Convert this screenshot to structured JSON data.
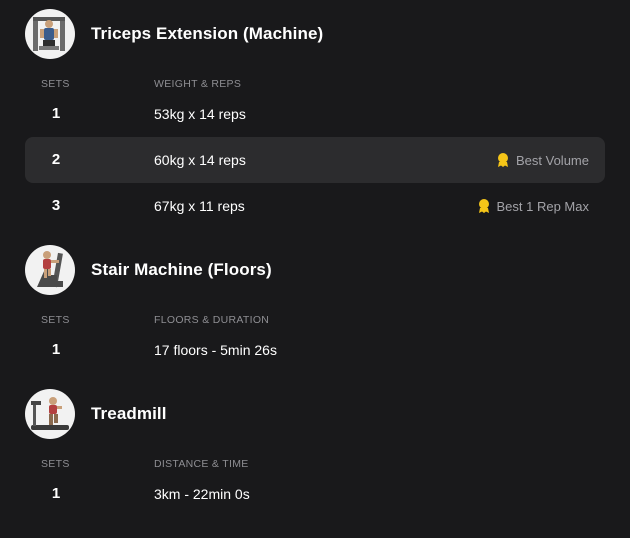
{
  "exercises": [
    {
      "name": "Triceps Extension (Machine)",
      "icon": "triceps-machine-icon",
      "col_sets": "SETS",
      "col_data": "WEIGHT & REPS",
      "sets": [
        {
          "num": "1",
          "value": "53kg x 14 reps",
          "record": ""
        },
        {
          "num": "2",
          "value": "60kg x 14 reps",
          "record": "Best Volume"
        },
        {
          "num": "3",
          "value": "67kg x 11 reps",
          "record": "Best 1 Rep Max"
        }
      ]
    },
    {
      "name": "Stair Machine (Floors)",
      "icon": "stair-machine-icon",
      "col_sets": "SETS",
      "col_data": "FLOORS & DURATION",
      "sets": [
        {
          "num": "1",
          "value": "17 floors - 5min 26s",
          "record": ""
        }
      ]
    },
    {
      "name": "Treadmill",
      "icon": "treadmill-icon",
      "col_sets": "SETS",
      "col_data": "DISTANCE & TIME",
      "sets": [
        {
          "num": "1",
          "value": "3km - 22min 0s",
          "record": ""
        }
      ]
    }
  ],
  "colors": {
    "background": "#19191b",
    "highlight_row": "#2c2c2e",
    "medal": "#f5c518",
    "muted_text": "#8e8e93"
  }
}
